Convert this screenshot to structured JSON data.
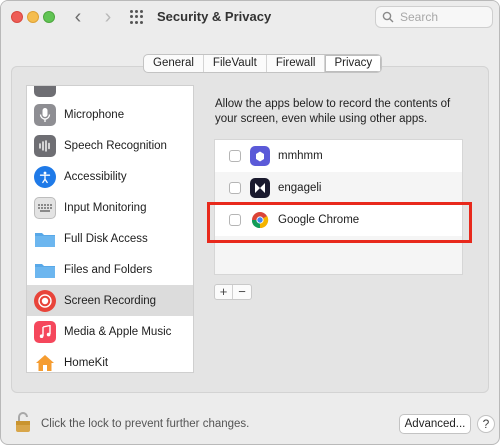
{
  "window": {
    "title": "Security & Privacy",
    "search_placeholder": "Search",
    "nav_back": "‹",
    "nav_forward": "›"
  },
  "tabs": [
    {
      "label": "General",
      "selected": false
    },
    {
      "label": "FileVault",
      "selected": false
    },
    {
      "label": "Firewall",
      "selected": false
    },
    {
      "label": "Privacy",
      "selected": true
    }
  ],
  "sidebar": {
    "items": [
      {
        "label": "Microphone",
        "icon": "microphone-icon"
      },
      {
        "label": "Speech Recognition",
        "icon": "waveform-icon"
      },
      {
        "label": "Accessibility",
        "icon": "accessibility-icon"
      },
      {
        "label": "Input Monitoring",
        "icon": "keyboard-icon"
      },
      {
        "label": "Full Disk Access",
        "icon": "folder-icon"
      },
      {
        "label": "Files and Folders",
        "icon": "folder-icon"
      },
      {
        "label": "Screen Recording",
        "icon": "screen-recording-icon",
        "selected": true
      },
      {
        "label": "Media & Apple Music",
        "icon": "music-icon"
      },
      {
        "label": "HomeKit",
        "icon": "home-icon"
      }
    ]
  },
  "main": {
    "description": "Allow the apps below to record the contents of your screen, even while using other apps.",
    "apps": [
      {
        "name": "mmhmm",
        "checked": false,
        "icon": "mmhmm-icon"
      },
      {
        "name": "engageli",
        "checked": false,
        "icon": "engageli-icon"
      },
      {
        "name": "Google Chrome",
        "checked": false,
        "icon": "chrome-icon"
      }
    ],
    "add_label": "+",
    "remove_label": "−"
  },
  "footer": {
    "lock_text": "Click the lock to prevent further changes.",
    "advanced_label": "Advanced...",
    "help_label": "?"
  },
  "colors": {
    "highlight": "#e8291c",
    "screen_recording_icon": "#e8443a",
    "folder": "#58a8e8"
  }
}
